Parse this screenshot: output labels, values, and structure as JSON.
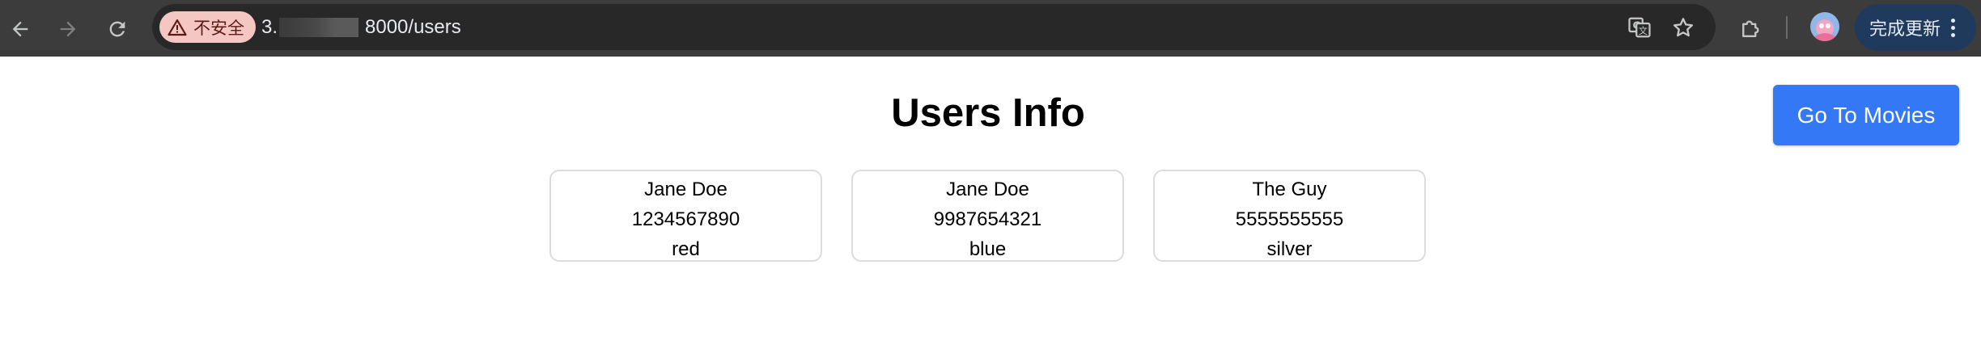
{
  "browser": {
    "security_label": "不安全",
    "url_prefix": "3.",
    "url_suffix": "8000/users",
    "update_button_label": "完成更新",
    "icons": {
      "back": "arrow-left-icon",
      "forward": "arrow-right-icon",
      "reload": "reload-icon",
      "warning": "warning-triangle-icon",
      "translate": "translate-icon",
      "bookmark": "star-icon",
      "extensions": "puzzle-icon",
      "menu": "kebab-menu-icon"
    }
  },
  "page": {
    "title": "Users Info",
    "movies_button_label": "Go To Movies",
    "users": [
      {
        "name": "Jane Doe",
        "phone": "1234567890",
        "color": "red"
      },
      {
        "name": "Jane Doe",
        "phone": "9987654321",
        "color": "blue"
      },
      {
        "name": "The Guy",
        "phone": "5555555555",
        "color": "silver"
      }
    ]
  },
  "colors": {
    "toolbar_bg": "#3c3c3c",
    "omnibox_bg": "#282828",
    "security_chip_bg": "#f4c7c3",
    "primary_button": "#3478f6",
    "update_button_bg": "#1f3a5c"
  }
}
